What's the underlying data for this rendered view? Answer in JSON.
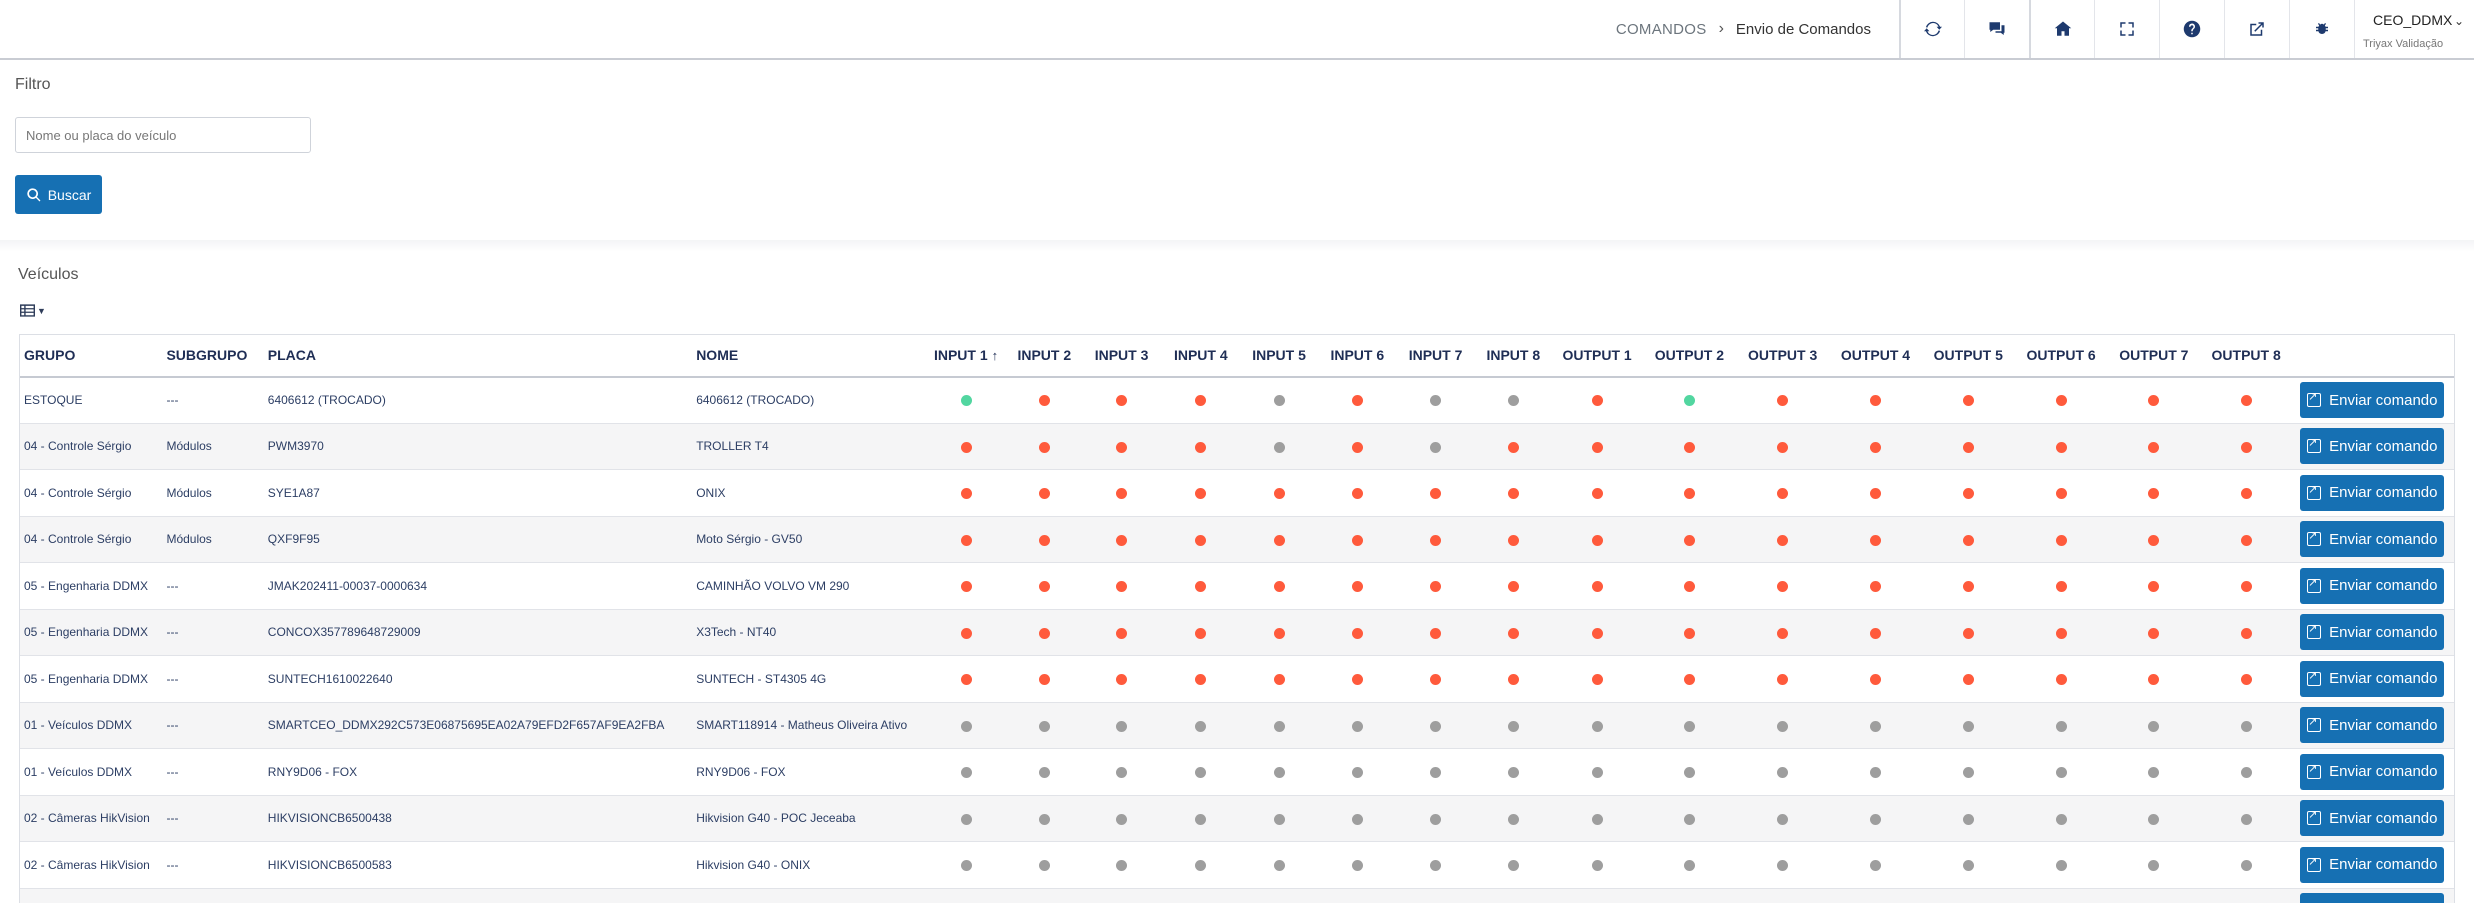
{
  "breadcrumb": {
    "root": "COMANDOS",
    "current": "Envio de Comandos"
  },
  "toolbar": [
    {
      "icon": "refresh-icon"
    },
    {
      "icon": "chat-icon"
    },
    {
      "icon": "home-icon"
    },
    {
      "icon": "fullscreen-icon"
    },
    {
      "icon": "help-icon"
    },
    {
      "icon": "external-link-icon"
    },
    {
      "icon": "bug-icon"
    }
  ],
  "user": {
    "name": "CEO_DDMX",
    "org": "Triyax Validação"
  },
  "filter": {
    "title": "Filtro",
    "placeholder": "Nome ou placa do veículo",
    "search_label": "Buscar"
  },
  "vehicles": {
    "title": "Veículos",
    "columns": [
      "GRUPO",
      "SUBGRUPO",
      "PLACA",
      "NOME",
      "INPUT 1",
      "INPUT 2",
      "INPUT 3",
      "INPUT 4",
      "INPUT 5",
      "INPUT 6",
      "INPUT 7",
      "INPUT 8",
      "OUTPUT 1",
      "OUTPUT 2",
      "OUTPUT 3",
      "OUTPUT 4",
      "OUTPUT 5",
      "OUTPUT 6",
      "OUTPUT 7",
      "OUTPUT 8"
    ],
    "sorted_column": "INPUT 1",
    "send_label": "Enviar comando",
    "status_colors": {
      "on": "#ff5a3c",
      "off": "#9e9e9e",
      "ok": "#52d6a0"
    },
    "rows": [
      {
        "grupo": "ESTOQUE",
        "subgrupo": "---",
        "placa": "6406612 (TROCADO)",
        "nome": "6406612 (TROCADO)",
        "inputs": [
          "ok",
          "on",
          "on",
          "on",
          "off",
          "on",
          "off",
          "off"
        ],
        "outputs": [
          "on",
          "ok",
          "on",
          "on",
          "on",
          "on",
          "on",
          "on"
        ]
      },
      {
        "grupo": "04 - Controle Sérgio",
        "subgrupo": "Módulos",
        "placa": "PWM3970",
        "nome": "TROLLER T4",
        "inputs": [
          "on",
          "on",
          "on",
          "on",
          "off",
          "on",
          "off",
          "on"
        ],
        "outputs": [
          "on",
          "on",
          "on",
          "on",
          "on",
          "on",
          "on",
          "on"
        ]
      },
      {
        "grupo": "04 - Controle Sérgio",
        "subgrupo": "Módulos",
        "placa": "SYE1A87",
        "nome": "ONIX",
        "inputs": [
          "on",
          "on",
          "on",
          "on",
          "on",
          "on",
          "on",
          "on"
        ],
        "outputs": [
          "on",
          "on",
          "on",
          "on",
          "on",
          "on",
          "on",
          "on"
        ]
      },
      {
        "grupo": "04 - Controle Sérgio",
        "subgrupo": "Módulos",
        "placa": "QXF9F95",
        "nome": "Moto Sérgio - GV50",
        "inputs": [
          "on",
          "on",
          "on",
          "on",
          "on",
          "on",
          "on",
          "on"
        ],
        "outputs": [
          "on",
          "on",
          "on",
          "on",
          "on",
          "on",
          "on",
          "on"
        ]
      },
      {
        "grupo": "05 - Engenharia DDMX",
        "subgrupo": "---",
        "placa": "JMAK202411-00037-0000634",
        "nome": "CAMINHÃO VOLVO VM 290",
        "inputs": [
          "on",
          "on",
          "on",
          "on",
          "on",
          "on",
          "on",
          "on"
        ],
        "outputs": [
          "on",
          "on",
          "on",
          "on",
          "on",
          "on",
          "on",
          "on"
        ]
      },
      {
        "grupo": "05 - Engenharia DDMX",
        "subgrupo": "---",
        "placa": "CONCOX357789648729009",
        "nome": "X3Tech - NT40",
        "inputs": [
          "on",
          "on",
          "on",
          "on",
          "on",
          "on",
          "on",
          "on"
        ],
        "outputs": [
          "on",
          "on",
          "on",
          "on",
          "on",
          "on",
          "on",
          "on"
        ]
      },
      {
        "grupo": "05 - Engenharia DDMX",
        "subgrupo": "---",
        "placa": "SUNTECH1610022640",
        "nome": "SUNTECH - ST4305 4G",
        "inputs": [
          "on",
          "on",
          "on",
          "on",
          "on",
          "on",
          "on",
          "on"
        ],
        "outputs": [
          "on",
          "on",
          "on",
          "on",
          "on",
          "on",
          "on",
          "on"
        ]
      },
      {
        "grupo": "01 - Veículos DDMX",
        "subgrupo": "---",
        "placa": "SMARTCEO_DDMX292C573E06875695EA02A79EFD2F657AF9EA2FBA",
        "nome": "SMART118914 - Matheus Oliveira Ativo",
        "inputs": [
          "off",
          "off",
          "off",
          "off",
          "off",
          "off",
          "off",
          "off"
        ],
        "outputs": [
          "off",
          "off",
          "off",
          "off",
          "off",
          "off",
          "off",
          "off"
        ]
      },
      {
        "grupo": "01 - Veículos DDMX",
        "subgrupo": "---",
        "placa": "RNY9D06 - FOX",
        "nome": "RNY9D06 - FOX",
        "inputs": [
          "off",
          "off",
          "off",
          "off",
          "off",
          "off",
          "off",
          "off"
        ],
        "outputs": [
          "off",
          "off",
          "off",
          "off",
          "off",
          "off",
          "off",
          "off"
        ]
      },
      {
        "grupo": "02 - Câmeras HikVision",
        "subgrupo": "---",
        "placa": "HIKVISIONCB6500438",
        "nome": "Hikvision G40 - POC Jeceaba",
        "inputs": [
          "off",
          "off",
          "off",
          "off",
          "off",
          "off",
          "off",
          "off"
        ],
        "outputs": [
          "off",
          "off",
          "off",
          "off",
          "off",
          "off",
          "off",
          "off"
        ]
      },
      {
        "grupo": "02 - Câmeras HikVision",
        "subgrupo": "---",
        "placa": "HIKVISIONCB6500583",
        "nome": "Hikvision G40 - ONIX",
        "inputs": [
          "off",
          "off",
          "off",
          "off",
          "off",
          "off",
          "off",
          "off"
        ],
        "outputs": [
          "off",
          "off",
          "off",
          "off",
          "off",
          "off",
          "off",
          "off"
        ]
      },
      {
        "grupo": "",
        "subgrupo": "",
        "placa": "",
        "nome": "",
        "inputs": [
          "off",
          "off",
          "off",
          "off",
          "off",
          "off",
          "off",
          "off"
        ],
        "outputs": [
          "off",
          "off",
          "off",
          "off",
          "off",
          "off",
          "off",
          "off"
        ]
      }
    ]
  }
}
